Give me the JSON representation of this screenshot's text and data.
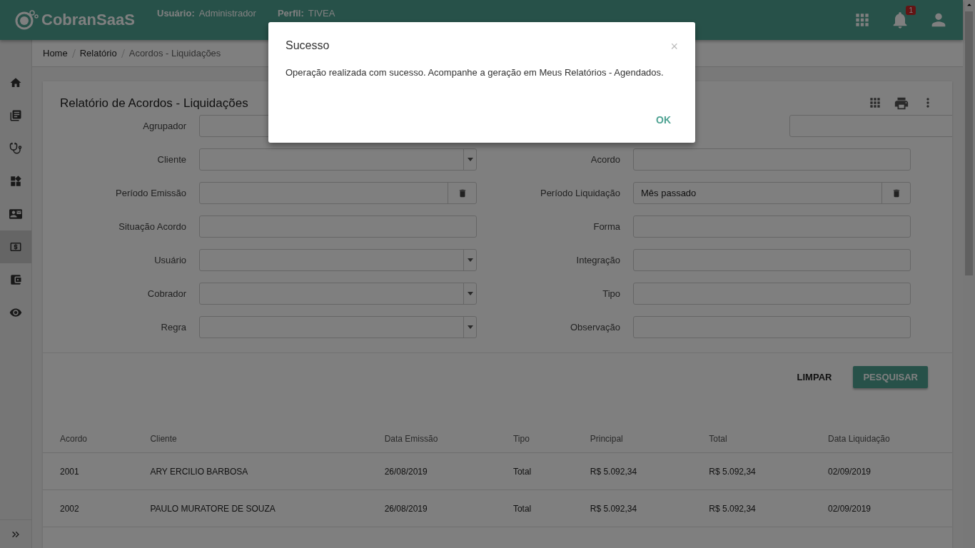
{
  "header": {
    "brand": "CobranSaaS",
    "user_label": "Usuário:",
    "user_value": "Administrador",
    "profile_label": "Perfil:",
    "profile_value": "TIVEA",
    "notification_count": "1"
  },
  "sidebar": {
    "items": [
      {
        "selected": false
      },
      {
        "selected": false
      },
      {
        "selected": false
      },
      {
        "selected": false
      },
      {
        "selected": false
      },
      {
        "selected": true
      },
      {
        "selected": false
      },
      {
        "selected": false
      }
    ]
  },
  "breadcrumb": [
    "Home",
    "Relatório",
    "Acordos - Liquidações"
  ],
  "card": {
    "title": "Relatório de Acordos - Liquidações",
    "left_fields": [
      {
        "label": "Agrupador",
        "kind": "select"
      },
      {
        "label": "Cliente",
        "kind": "select"
      },
      {
        "label": "Período Emissão",
        "kind": "date"
      },
      {
        "label": "Situação Acordo",
        "kind": "text"
      },
      {
        "label": "Usuário",
        "kind": "select"
      },
      {
        "label": "Cobrador",
        "kind": "select"
      },
      {
        "label": "Regra",
        "kind": "select"
      }
    ],
    "right_fields": [
      {
        "kind": "select"
      },
      {
        "label": "Acordo",
        "kind": "text"
      },
      {
        "label": "Período Liquidação",
        "kind": "date",
        "value": "Mês passado"
      },
      {
        "label": "Forma",
        "kind": "text"
      },
      {
        "label": "Integração",
        "kind": "text"
      },
      {
        "label": "Tipo",
        "kind": "text"
      },
      {
        "label": "Observação",
        "kind": "text"
      }
    ],
    "buttons": [
      {
        "label": "LIMPAR",
        "kind": "flat"
      },
      {
        "label": "PESQUISAR",
        "kind": "raised"
      }
    ]
  },
  "table": {
    "columns": [
      "Acordo",
      "Cliente",
      "Data Emissão",
      "Tipo",
      "Principal",
      "Total",
      "Data Liquidação"
    ],
    "rows": [
      [
        "2001",
        "ARY ERCILIO BARBOSA",
        "26/08/2019",
        "Total",
        "R$ 5.092,34",
        "R$ 5.092,34",
        "02/09/2019"
      ],
      [
        "2002",
        "PAULO MURATORE DE SOUZA",
        "26/08/2019",
        "Total",
        "R$ 5.092,34",
        "R$ 5.092,34",
        "02/09/2019"
      ]
    ]
  },
  "dialog": {
    "title": "Sucesso",
    "close": "×",
    "message": "Operação realizada com sucesso. Acompanhe a geração em Meus Relatórios - Agendados.",
    "button": "OK"
  }
}
